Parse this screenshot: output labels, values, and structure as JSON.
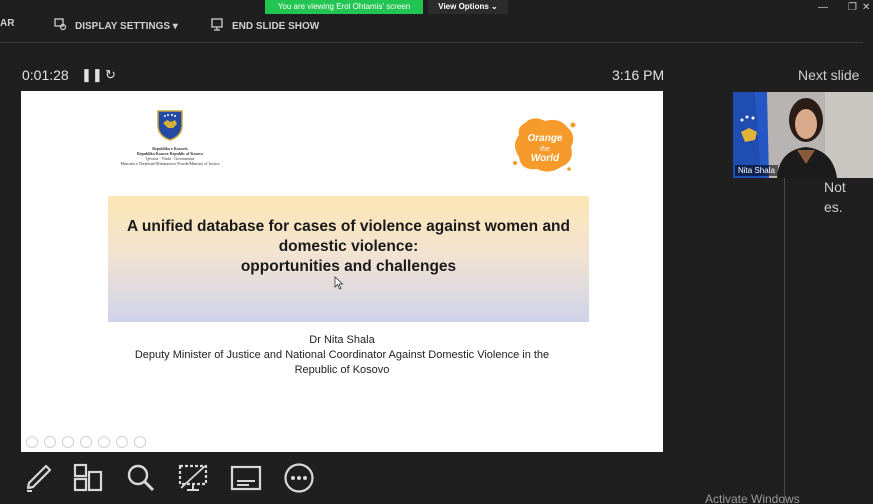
{
  "banner": {
    "viewing_text": "You are viewing Erol Ohtamis' screen",
    "view_options_label": "View Options ⌄"
  },
  "toolbar": {
    "partial_label": "AR",
    "display_settings_label": "DISPLAY SETTINGS ▾",
    "end_slide_show_label": "END SLIDE SHOW"
  },
  "presenter": {
    "timer": "0:01:28",
    "clock": "3:16 PM",
    "next_slide_label": "Next slide",
    "participant_name": "Nita Shala",
    "notes_text": "Not\nes."
  },
  "slide": {
    "crest_lines": [
      "Republika e Kosovës",
      "Republika Kosova-Republic of Kosovo",
      "Qeveria - Vlada - Government",
      "Ministria e Drejtësisë/Ministarstvo Pravde/Ministry of Justice"
    ],
    "title_line1": "A unified database for cases of violence against women and",
    "title_line2": "domestic violence:",
    "title_line3": "opportunities and challenges",
    "presenter_name": "Dr Nita Shala",
    "presenter_role_line1": "Deputy Minister of Justice and National Coordinator Against Domestic Violence in the",
    "presenter_role_line2": "Republic of Kosovo"
  },
  "bottom_tools": [
    "pen-icon",
    "grid-icon",
    "magnifier-icon",
    "screen-icon",
    "subtitles-icon",
    "more-icon"
  ],
  "watermark": "Activate Windows",
  "colors": {
    "background": "#1f1f1f",
    "share_banner": "#23c552",
    "slide_title_gradient_top": "#fde7b4",
    "slide_title_gradient_bottom": "#cfd3ea"
  }
}
